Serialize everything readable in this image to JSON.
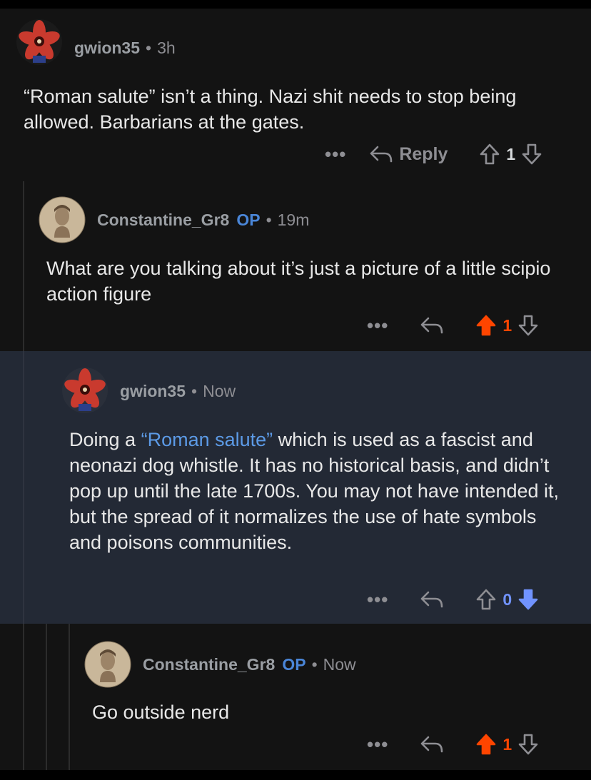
{
  "comments": [
    {
      "username": "gwion35",
      "op_badge": "",
      "time": "3h",
      "body": "“Roman salute” isn’t a thing.  Nazi shit needs to stop being allowed.  Barbarians at the gates.",
      "reply_label": "Reply",
      "score": "1",
      "vote_state": "none"
    },
    {
      "username": "Constantine_Gr8",
      "op_badge": "OP",
      "time": "19m",
      "body": "What are you talking about it’s just a picture of a little scipio action figure",
      "score": "1",
      "vote_state": "up"
    },
    {
      "username": "gwion35",
      "time": "Now",
      "body_link": "“Roman salute”",
      "body_rest": " which is used as a fascist and neonazi dog whistle.  It has no historical basis, and didn’t pop up until the late 1700s.  You may not have intended it, but the spread of it normalizes the use of hate symbols and poisons communities.",
      "body_prefix": "Doing a ",
      "score": "0",
      "vote_state": "down"
    },
    {
      "username": "Constantine_Gr8",
      "op_badge": "OP",
      "time": "Now",
      "body": "Go outside nerd",
      "score": "1",
      "vote_state": "up"
    }
  ],
  "separator": "•",
  "more_label": "•••",
  "colors": {
    "background": "#131313",
    "highlight_background": "#232935",
    "upvote": "#ff4500",
    "downvote": "#7193ff",
    "op_badge": "#4a86d8",
    "link": "#5c9ae6"
  },
  "icons": [
    "demogorgon-avatar",
    "roman-bust-avatar",
    "reply-arrow-icon",
    "upvote-arrow-icon",
    "downvote-arrow-icon",
    "more-options-icon"
  ]
}
